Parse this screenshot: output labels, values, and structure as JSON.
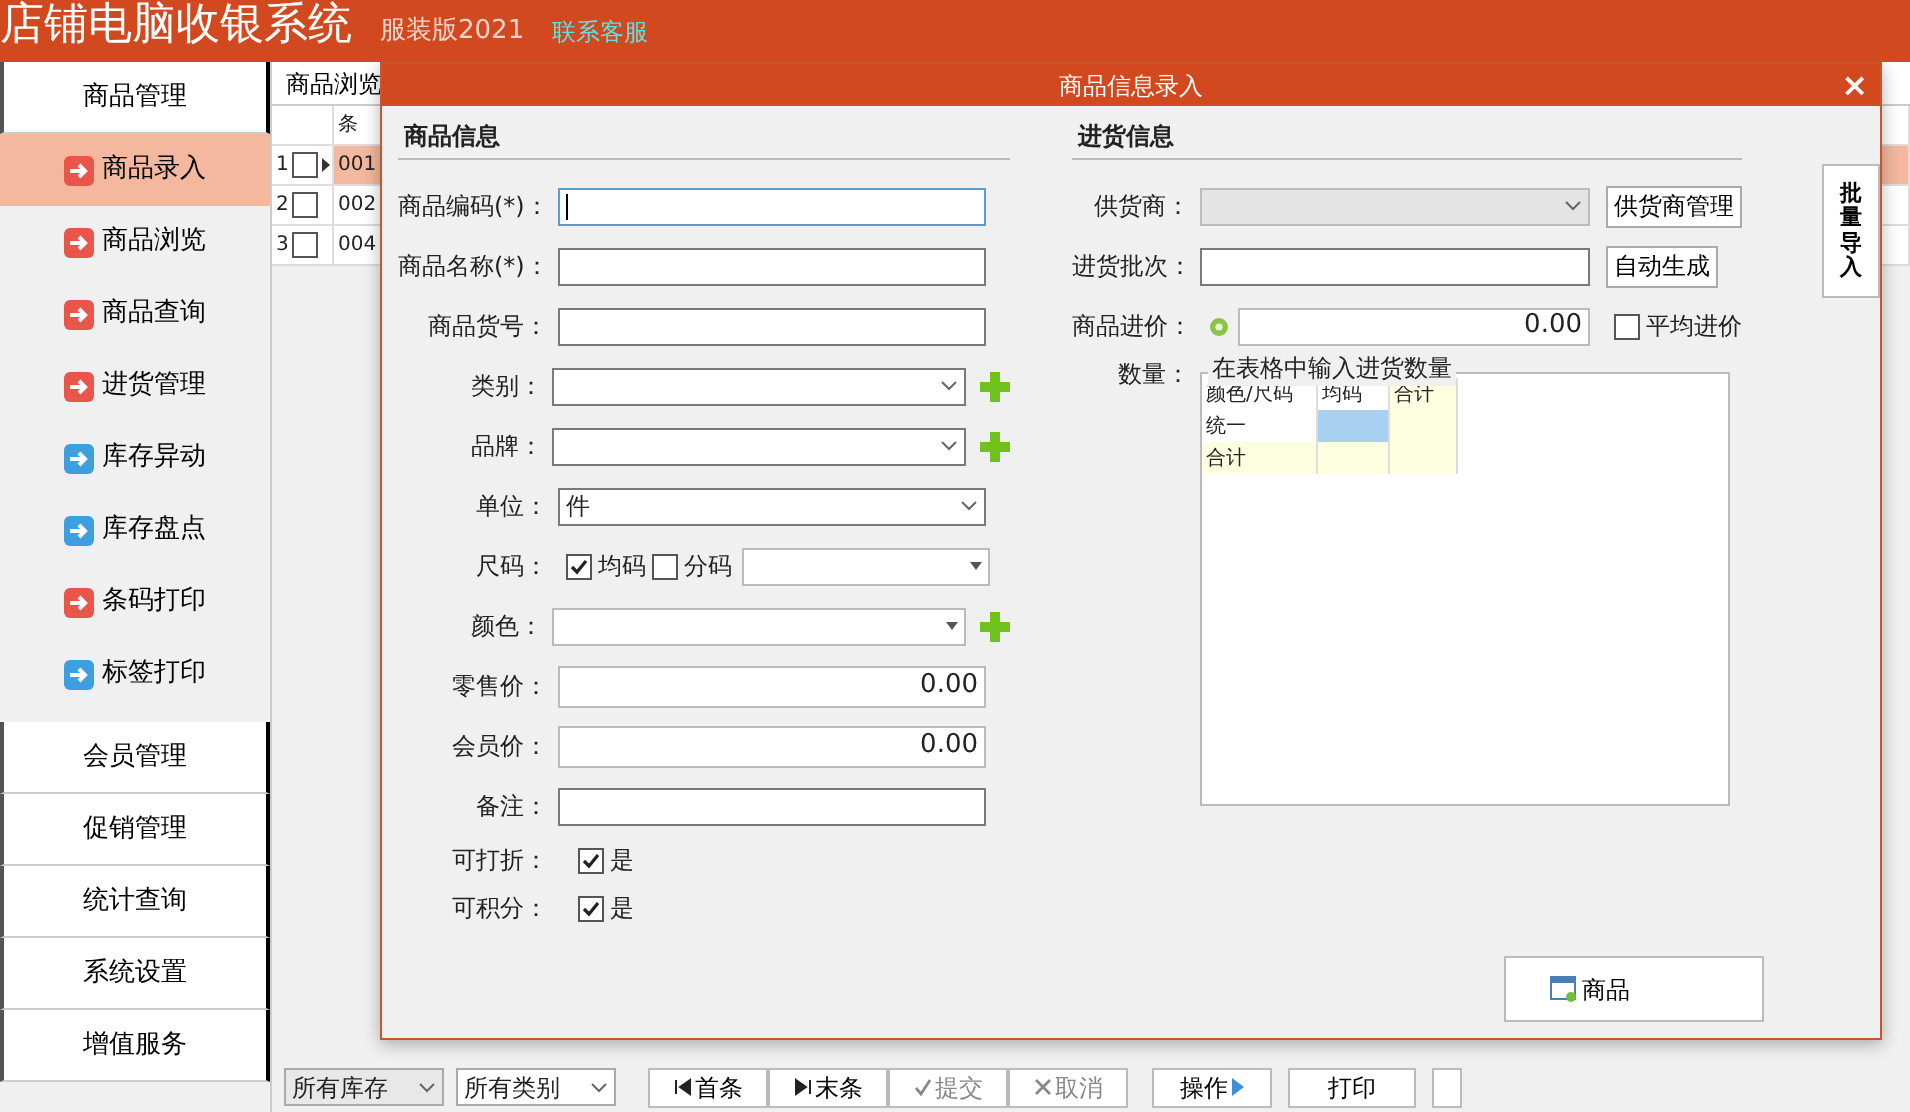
{
  "app": {
    "title": "店铺电脑收银系统",
    "edition": "服装版2021",
    "support_link": "联系客服"
  },
  "sidebar": {
    "groups": [
      {
        "label": "商品管理",
        "items": [
          {
            "label": "商品录入",
            "selected": true,
            "color": "#e9554a"
          },
          {
            "label": "商品浏览",
            "selected": false,
            "color": "#e9554a"
          },
          {
            "label": "商品查询",
            "selected": false,
            "color": "#e9554a"
          },
          {
            "label": "进货管理",
            "selected": false,
            "color": "#e9554a"
          },
          {
            "label": "库存异动",
            "selected": false,
            "color": "#3d9ee0"
          },
          {
            "label": "库存盘点",
            "selected": false,
            "color": "#3d9ee0"
          },
          {
            "label": "条码打印",
            "selected": false,
            "color": "#e9554a"
          },
          {
            "label": "标签打印",
            "selected": false,
            "color": "#3d9ee0"
          }
        ]
      },
      {
        "label": "会员管理"
      },
      {
        "label": "促销管理"
      },
      {
        "label": "统计查询"
      },
      {
        "label": "系统设置"
      },
      {
        "label": "增值服务"
      }
    ]
  },
  "browse_panel": {
    "tab": "商品浏览",
    "columns": [
      "条"
    ],
    "rows": [
      {
        "number": "1",
        "checked": false,
        "selected": true,
        "code": "001"
      },
      {
        "number": "2",
        "checked": false,
        "selected": false,
        "code": "002"
      },
      {
        "number": "3",
        "checked": false,
        "selected": false,
        "code": "004"
      }
    ]
  },
  "toolbar": {
    "filters": [
      "所有库存",
      "所有类别"
    ],
    "buttons": [
      {
        "label": "首条",
        "kind": "first",
        "disabled": false
      },
      {
        "label": "末条",
        "kind": "last",
        "disabled": false
      },
      {
        "label": "提交",
        "kind": "submit",
        "disabled": true
      },
      {
        "label": "取消",
        "kind": "cancel",
        "disabled": true
      },
      {
        "label": "操作",
        "kind": "menu",
        "disabled": false
      },
      {
        "label": "打印",
        "kind": "plain",
        "disabled": false
      }
    ]
  },
  "dialog": {
    "title": "商品信息录入",
    "close": "×",
    "left_section": {
      "heading": "商品信息",
      "fields": [
        {
          "kind": "text",
          "label": "商品编码(*)：",
          "focused": true
        },
        {
          "kind": "text",
          "label": "商品名称(*)：",
          "focused": false
        },
        {
          "kind": "text",
          "label": "商品货号：",
          "focused": false
        },
        {
          "kind": "select",
          "label": "类别：",
          "add": true
        },
        {
          "kind": "select",
          "label": "品牌：",
          "add": true
        },
        {
          "kind": "select",
          "label": "单位：",
          "value": "件",
          "add": false
        },
        {
          "kind": "sizes",
          "label": "尺码：",
          "options": [
            {
              "label": "均码",
              "checked": true
            },
            {
              "label": "分码",
              "checked": false
            }
          ]
        },
        {
          "kind": "combo",
          "label": "颜色：",
          "add": true
        },
        {
          "kind": "number",
          "label": "零售价：",
          "value": "0.00"
        },
        {
          "kind": "number",
          "label": "会员价：",
          "value": "0.00"
        },
        {
          "kind": "text",
          "label": "备注：",
          "focused": false
        },
        {
          "kind": "check",
          "label": "可打折：",
          "option": "是",
          "checked": true
        },
        {
          "kind": "check",
          "label": "可积分：",
          "option": "是",
          "checked": true
        }
      ]
    },
    "right_section": {
      "heading": "进货信息",
      "fields": [
        {
          "kind": "select",
          "label": "供货商：",
          "disabled": true,
          "button": "供货商管理"
        },
        {
          "kind": "text",
          "label": "进货批次：",
          "disabled": false,
          "button": "自动生成"
        },
        {
          "kind": "price",
          "label": "商品进价：",
          "value": "0.00",
          "option": {
            "label": "平均进价",
            "checked": false
          }
        }
      ],
      "quantity": {
        "label": "数量：",
        "legend": "在表格中输入进货数量",
        "columns": [
          "颜色/尺码",
          "均码",
          "合计"
        ],
        "rows": [
          {
            "label": "统一",
            "kind": "entry",
            "cells": [
              {
                "selected": true
              },
              {
                "selected": false
              }
            ]
          },
          {
            "label": "合计",
            "kind": "total",
            "cells": [
              {
                "selected": false
              },
              {
                "selected": false
              }
            ]
          }
        ]
      }
    },
    "side_button": "批量导入",
    "footer_button": "商品"
  }
}
